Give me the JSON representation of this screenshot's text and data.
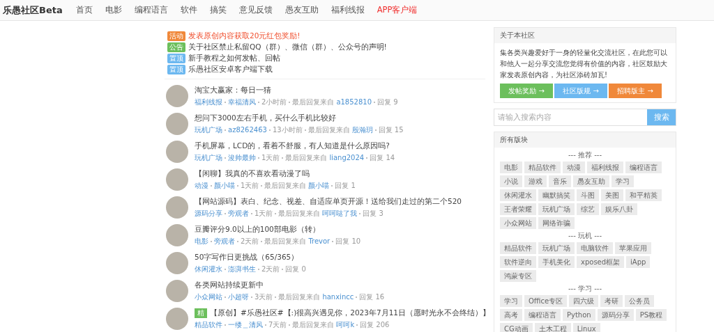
{
  "header": {
    "logo": "乐愚社区Beta",
    "nav": [
      {
        "label": "首页",
        "kind": "normal"
      },
      {
        "label": "电影",
        "kind": "normal"
      },
      {
        "label": "编程语言",
        "kind": "normal"
      },
      {
        "label": "软件",
        "kind": "normal"
      },
      {
        "label": "搞笑",
        "kind": "normal"
      },
      {
        "label": "意见反馈",
        "kind": "normal"
      },
      {
        "label": "愚友互助",
        "kind": "normal"
      },
      {
        "label": "福利线报",
        "kind": "normal"
      },
      {
        "label": "APP客户端",
        "kind": "highlight"
      }
    ]
  },
  "notices": [
    {
      "tag": "活动",
      "color": "#f0883a",
      "text": "发表原创内容获取20元红包奖励!",
      "kind": "highlight"
    },
    {
      "tag": "公告",
      "color": "#6cbf5c",
      "text": "关于社区禁止私留QQ（群）、微信（群）、公众号的声明!",
      "kind": "normal"
    },
    {
      "tag": "置顶",
      "color": "#6cb8f0",
      "text": "新手教程之如何发帖、回帖",
      "kind": "normal"
    },
    {
      "tag": "置顶",
      "color": "#6cb8f0",
      "text": "乐愚社区安卓客户端下载",
      "kind": "normal"
    }
  ],
  "posts": [
    {
      "title": "淘宝大赢家：每日一猜",
      "category": "福利线报",
      "author": "幸福清风",
      "time": "2小时前",
      "last_reply_label": "最后回复来自",
      "last_reply_user": "a1852810",
      "replies": "回复 9"
    },
    {
      "title": "想问下3000左右手机，买什么手机比较好",
      "category": "玩机广场",
      "author": "az8262463",
      "time": "13小时前",
      "last_reply_label": "最后回复来自",
      "last_reply_user": "殷瀚玥",
      "replies": "回复 15"
    },
    {
      "title": "手机屏幕，LCD的，看着不舒服，有人知道是什么原因吗?",
      "category": "玩机广场",
      "author": "浚帅最帅",
      "time": "1天前",
      "last_reply_label": "最后回复来自",
      "last_reply_user": "liang2024",
      "replies": "回复 14"
    },
    {
      "title": "【闲聊】我真的不喜欢看动漫了吗",
      "category": "动漫",
      "author": "颜小喵",
      "time": "1天前",
      "last_reply_label": "最后回复来自",
      "last_reply_user": "颜小喵",
      "replies": "回复 1"
    },
    {
      "title": "【网站源码】表白、纪念、视差、自适应单页开源！送给我们走过的第二个520",
      "category": "源码分享",
      "author": "旁观者",
      "time": "1天前",
      "last_reply_label": "最后回复来自",
      "last_reply_user": "呵呵哒了我",
      "replies": "回复 3"
    },
    {
      "title": "豆瓣评分9.0以上的100部电影（转）",
      "category": "电影",
      "author": "旁观者",
      "time": "2天前",
      "last_reply_label": "最后回复来自",
      "last_reply_user": "Trevor",
      "replies": "回复 10"
    },
    {
      "title": "50字写作日更挑战（65/365）",
      "category": "休闲灌水",
      "author": "澎湃书生",
      "time": "2天前",
      "replies": "回复 0"
    },
    {
      "title": "各类网站持续更新中",
      "category": "小众网站",
      "author": "小超呀",
      "time": "3天前",
      "last_reply_label": "最后回复来自",
      "last_reply_user": "hanxincc",
      "replies": "回复 16"
    },
    {
      "badge": "精",
      "title": "【原创】#乐愚社区#【:)很高兴遇见你，2023年7月11日（愿时光永不会终结）】",
      "category": "精品软件",
      "author": "一缕＿清风",
      "time": "7天前",
      "last_reply_label": "最后回复来自",
      "last_reply_user": "呵呵k",
      "replies": "回复 206"
    }
  ],
  "about": {
    "title": "关于本社区",
    "text": "集各类兴趣爱好于一身的轻量化交流社区，在此您可以和他人一起分享交流您觉得有价值的内容，社区鼓励大家发表原创内容，为社区添砖加瓦!",
    "buttons": [
      {
        "label": "发帖奖励 →",
        "color": "#6cbf5c"
      },
      {
        "label": "社区版规 →",
        "color": "#6cb8f0"
      },
      {
        "label": "招聘版主 →",
        "color": "#f0883a"
      }
    ]
  },
  "search": {
    "placeholder": "请输入搜索内容",
    "button": "搜索"
  },
  "boards": {
    "title": "所有版块",
    "groups": [
      {
        "label": "--- 推荐 ---",
        "tags": [
          "电影",
          "精品软件",
          "动漫",
          "福利线报",
          "编程语言",
          "小说",
          "游戏",
          "音乐",
          "愚友互助",
          "学习",
          "休闲灌水",
          "幽默搞笑",
          "斗图",
          "美图",
          "和平精英",
          "王者荣耀",
          "玩机广场",
          "综艺",
          "娱乐八卦",
          "小众网站",
          "网络诈骗"
        ]
      },
      {
        "label": "--- 玩机 ---",
        "tags": [
          "精品软件",
          "玩机广场",
          "电脑软件",
          "苹果应用",
          "软件逆向",
          "手机美化",
          "xposed框架",
          "iApp",
          "鸿蒙专区"
        ]
      },
      {
        "label": "--- 学习 ---",
        "tags": [
          "学习",
          "Office专区",
          "四六级",
          "考研",
          "公务员",
          "高考",
          "编程语言",
          "Python",
          "源码分享",
          "PS教程",
          "CG动画",
          "土木工程",
          "Linux"
        ]
      }
    ]
  }
}
